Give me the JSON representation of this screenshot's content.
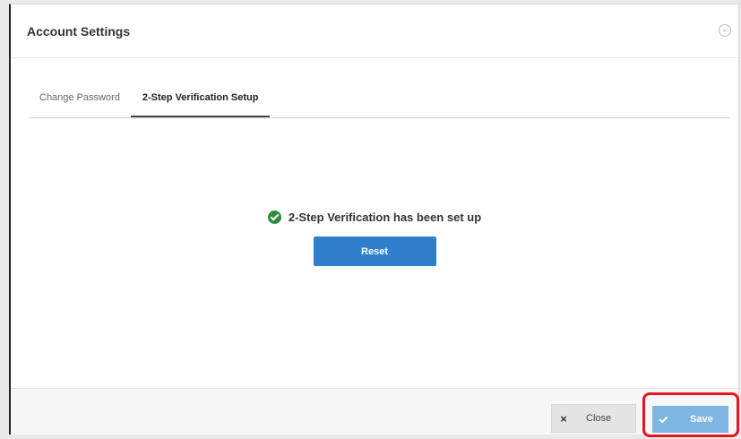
{
  "dialog": {
    "title": "Account Settings",
    "close_icon": "close-circle-icon"
  },
  "tabs": [
    {
      "label": "Change Password",
      "active": false
    },
    {
      "label": "2-Step Verification Setup",
      "active": true
    }
  ],
  "status": {
    "message": "2-Step Verification has been set up",
    "icon": "check-circle-icon",
    "icon_color": "#2e8b3e"
  },
  "reset_button": {
    "label": "Reset",
    "color": "#2f7fcc"
  },
  "footer": {
    "close_label": "Close",
    "close_icon": "x-icon",
    "save_label": "Save",
    "save_icon": "check-icon",
    "save_color": "#7eb5e2",
    "highlight_color": "#e5161f"
  }
}
